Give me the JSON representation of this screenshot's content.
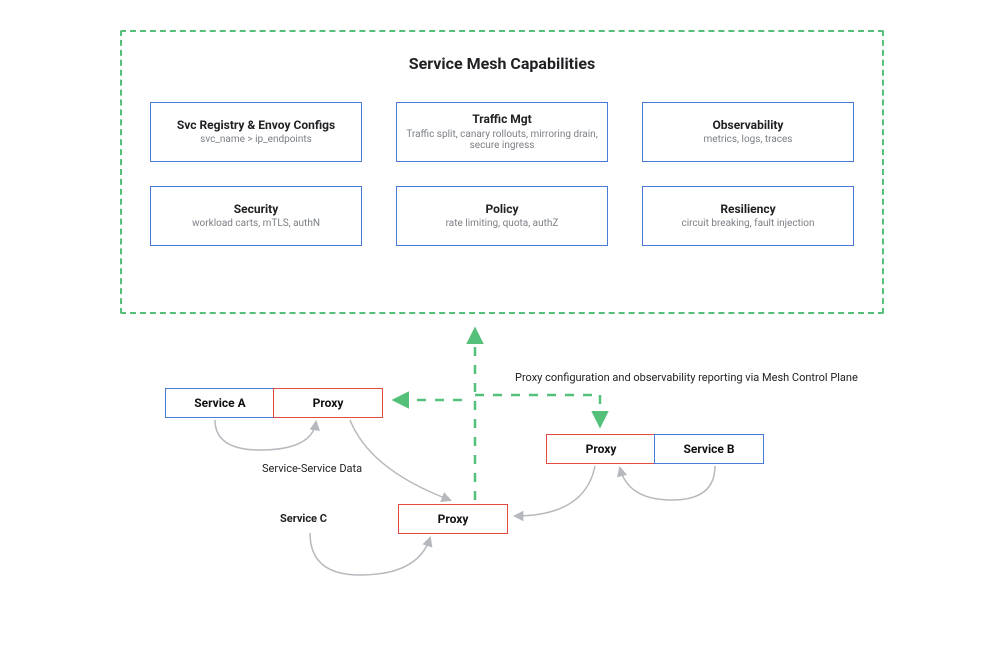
{
  "title": "Service Mesh Capabilities",
  "capabilities": [
    {
      "title": "Svc Registry & Envoy Configs",
      "sub": "svc_name >  ip_endpoints"
    },
    {
      "title": "Traffic Mgt",
      "sub": "Traffic split, canary rollouts, mirroring drain, secure ingress"
    },
    {
      "title": "Observability",
      "sub": "metrics, logs, traces"
    },
    {
      "title": "Security",
      "sub": "workload carts, mTLS, authN"
    },
    {
      "title": "Policy",
      "sub": "rate limiting, quota, authZ"
    },
    {
      "title": "Resiliency",
      "sub": "circuit breaking, fault injection"
    }
  ],
  "nodes": {
    "service_a": "Service A",
    "proxy_a": "Proxy",
    "service_b": "Service B",
    "proxy_b": "Proxy",
    "proxy_c": "Proxy",
    "service_c_label": "Service C"
  },
  "captions": {
    "mesh_control": "Proxy configuration and observability reporting via Mesh Control Plane",
    "svc_svc_data": "Service-Service Data"
  },
  "colors": {
    "dashed_green": "#55c07a",
    "blue_border": "#4a7bd6",
    "red_border": "#e04a3f",
    "arrow_gray": "#b5b9bd"
  }
}
